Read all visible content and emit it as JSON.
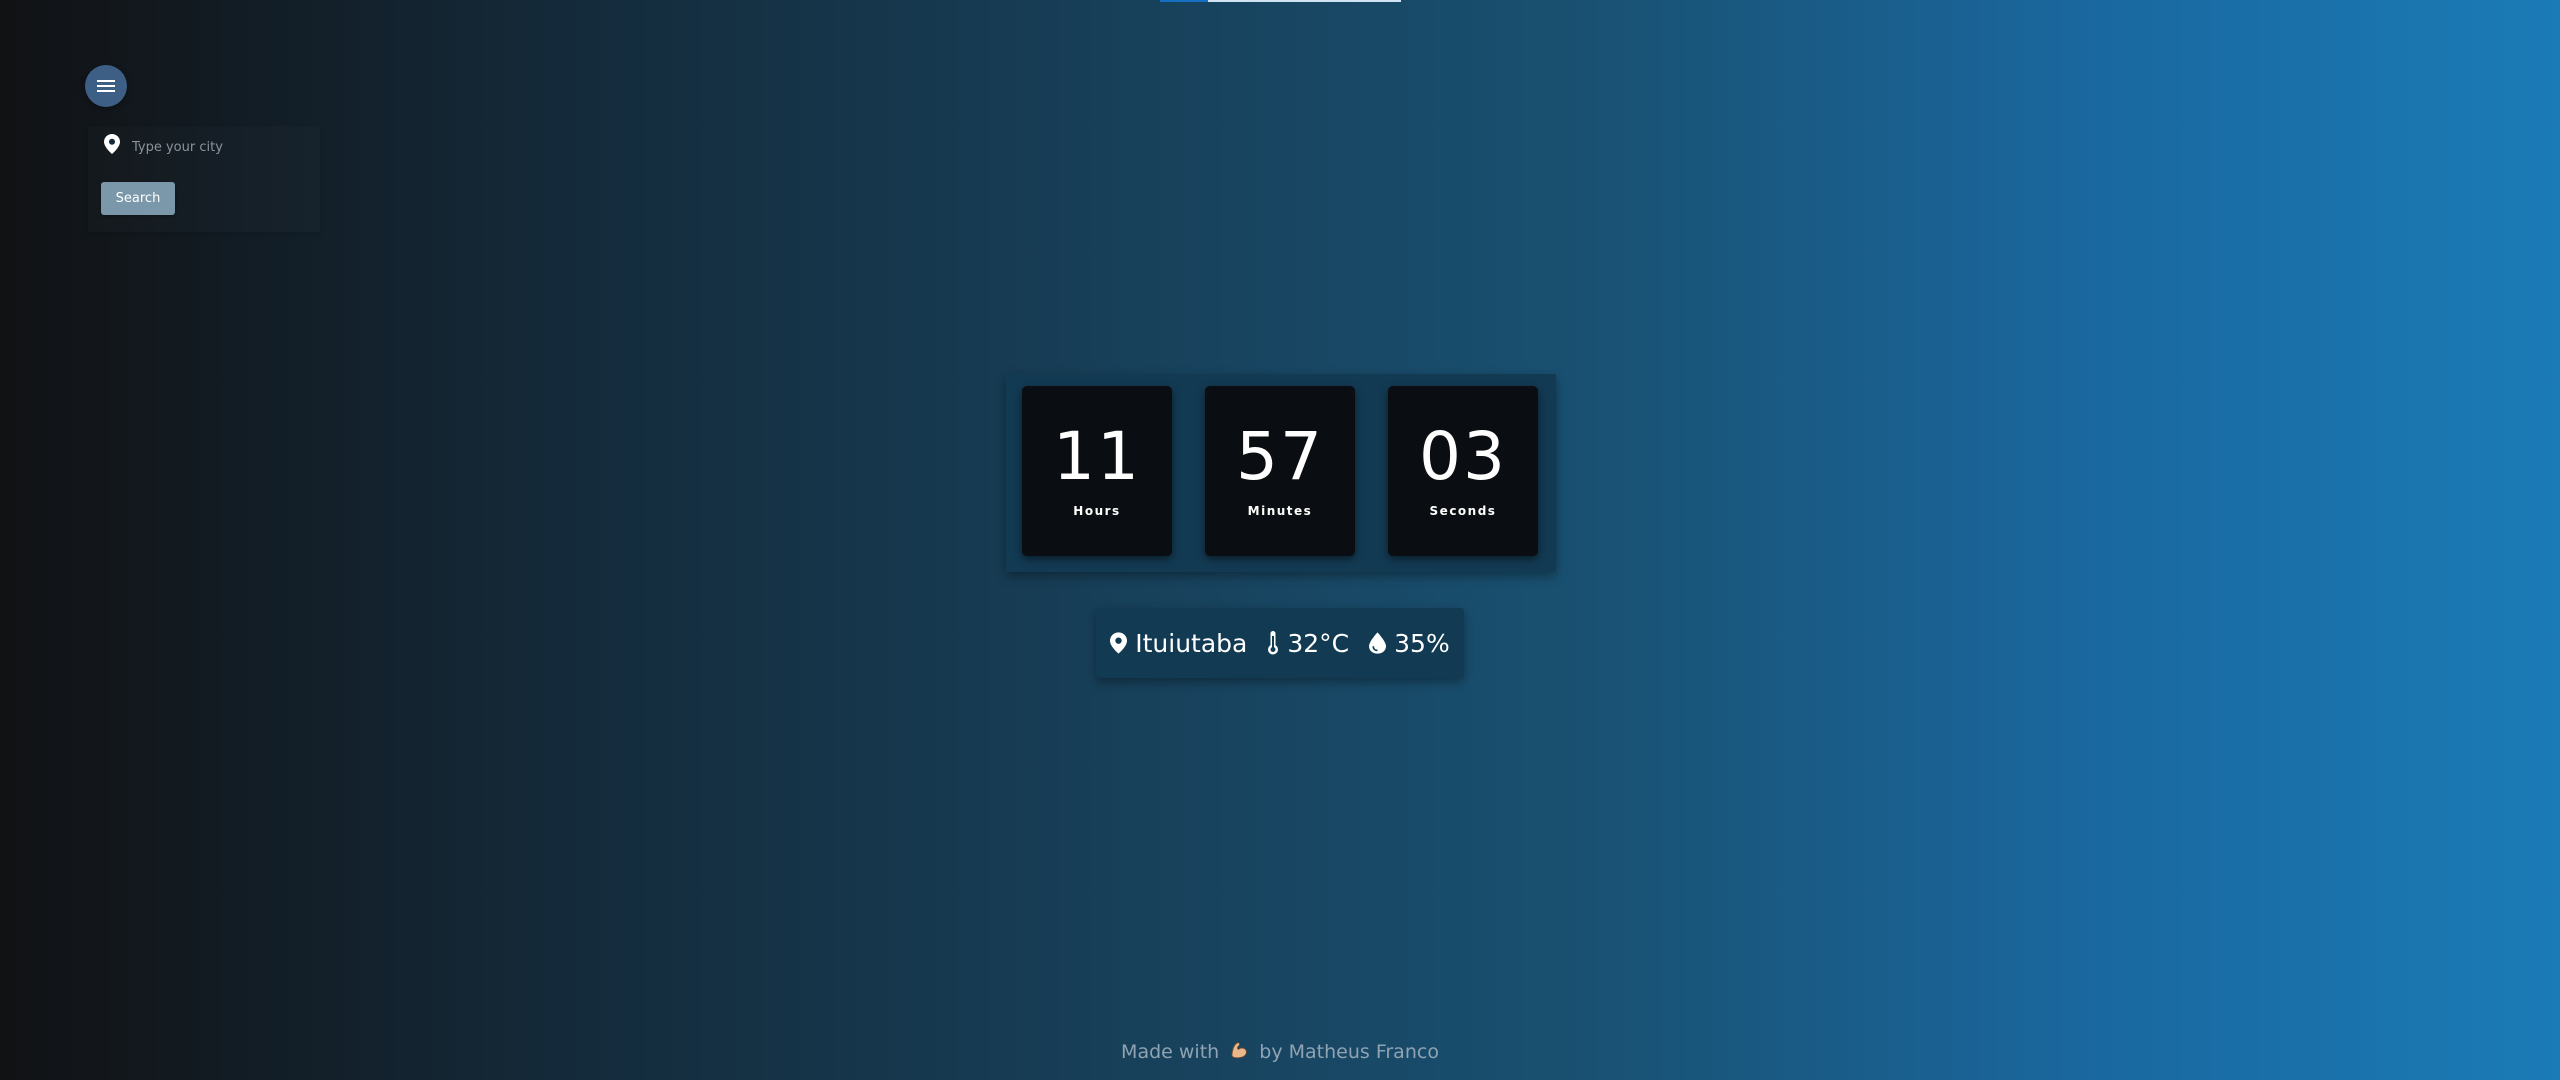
{
  "top_bar": {
    "progress": 0.2
  },
  "menu": {
    "icon": "hamburger-menu-icon"
  },
  "search": {
    "location_icon": "location-pin-icon",
    "placeholder": "Type your city",
    "value": "",
    "button_label": "Search"
  },
  "clock": {
    "hours": {
      "value": "11",
      "label": "Hours"
    },
    "minutes": {
      "value": "57",
      "label": "Minutes"
    },
    "seconds": {
      "value": "03",
      "label": "Seconds"
    }
  },
  "weather": {
    "location_icon": "location-pin-icon",
    "city": "Ituiutaba",
    "temperature_icon": "thermometer-icon",
    "temperature": "32°C",
    "humidity_icon": "water-drop-icon",
    "humidity": "35%"
  },
  "footer": {
    "prefix": "Made with",
    "emoji_icon": "flexed-biceps-icon",
    "suffix": "by Matheus Franco"
  },
  "colors": {
    "background_start": "#111214",
    "background_end": "#1b7bb6",
    "panel": "#133a53",
    "clock_card": "#0a0d11",
    "menu_button": "#3d5f86",
    "search_button": "#7a98aa",
    "footer_text": "#8fa3b3",
    "top_bar_fill": "#1570c4"
  }
}
